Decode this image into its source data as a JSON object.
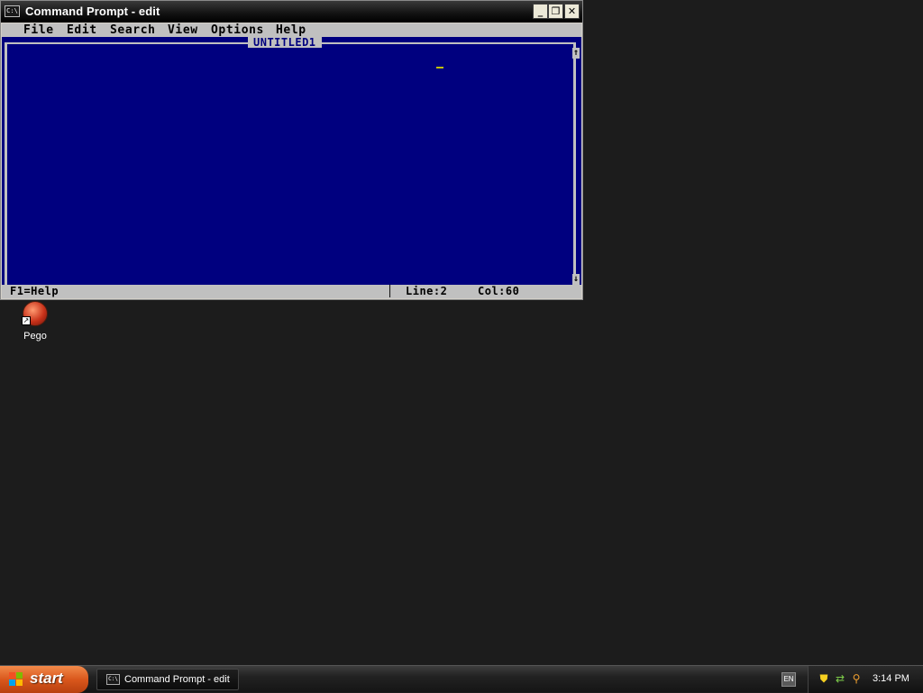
{
  "window": {
    "title": "Command Prompt - edit",
    "icon_text": "C:\\",
    "buttons": {
      "minimize": "_",
      "maximize": "❐",
      "close": "✕"
    }
  },
  "editor": {
    "menu": [
      {
        "label": "File"
      },
      {
        "label": "Edit"
      },
      {
        "label": "Search"
      },
      {
        "label": "View"
      },
      {
        "label": "Options"
      },
      {
        "label": "Help"
      }
    ],
    "document_title": "UNTITLED1",
    "scroll_up": "↑",
    "scroll_down": "↓",
    "status": {
      "help": "F1=Help",
      "separator": "│",
      "line": "Line:2",
      "col": "Col:60"
    },
    "colors": {
      "background": "#00007f",
      "chrome": "#c0c0c0",
      "cursor": "#c0c000"
    }
  },
  "desktop": {
    "icons": [
      {
        "label": "Pego",
        "icon": "pego-app-icon"
      }
    ]
  },
  "taskbar": {
    "start_label": "start",
    "task_label": "Command Prompt - edit",
    "task_icon_text": "C:\\",
    "language": "EN",
    "tray_icons": [
      "shield-icon",
      "network-icon",
      "search-icon"
    ],
    "clock": "3:14 PM"
  }
}
